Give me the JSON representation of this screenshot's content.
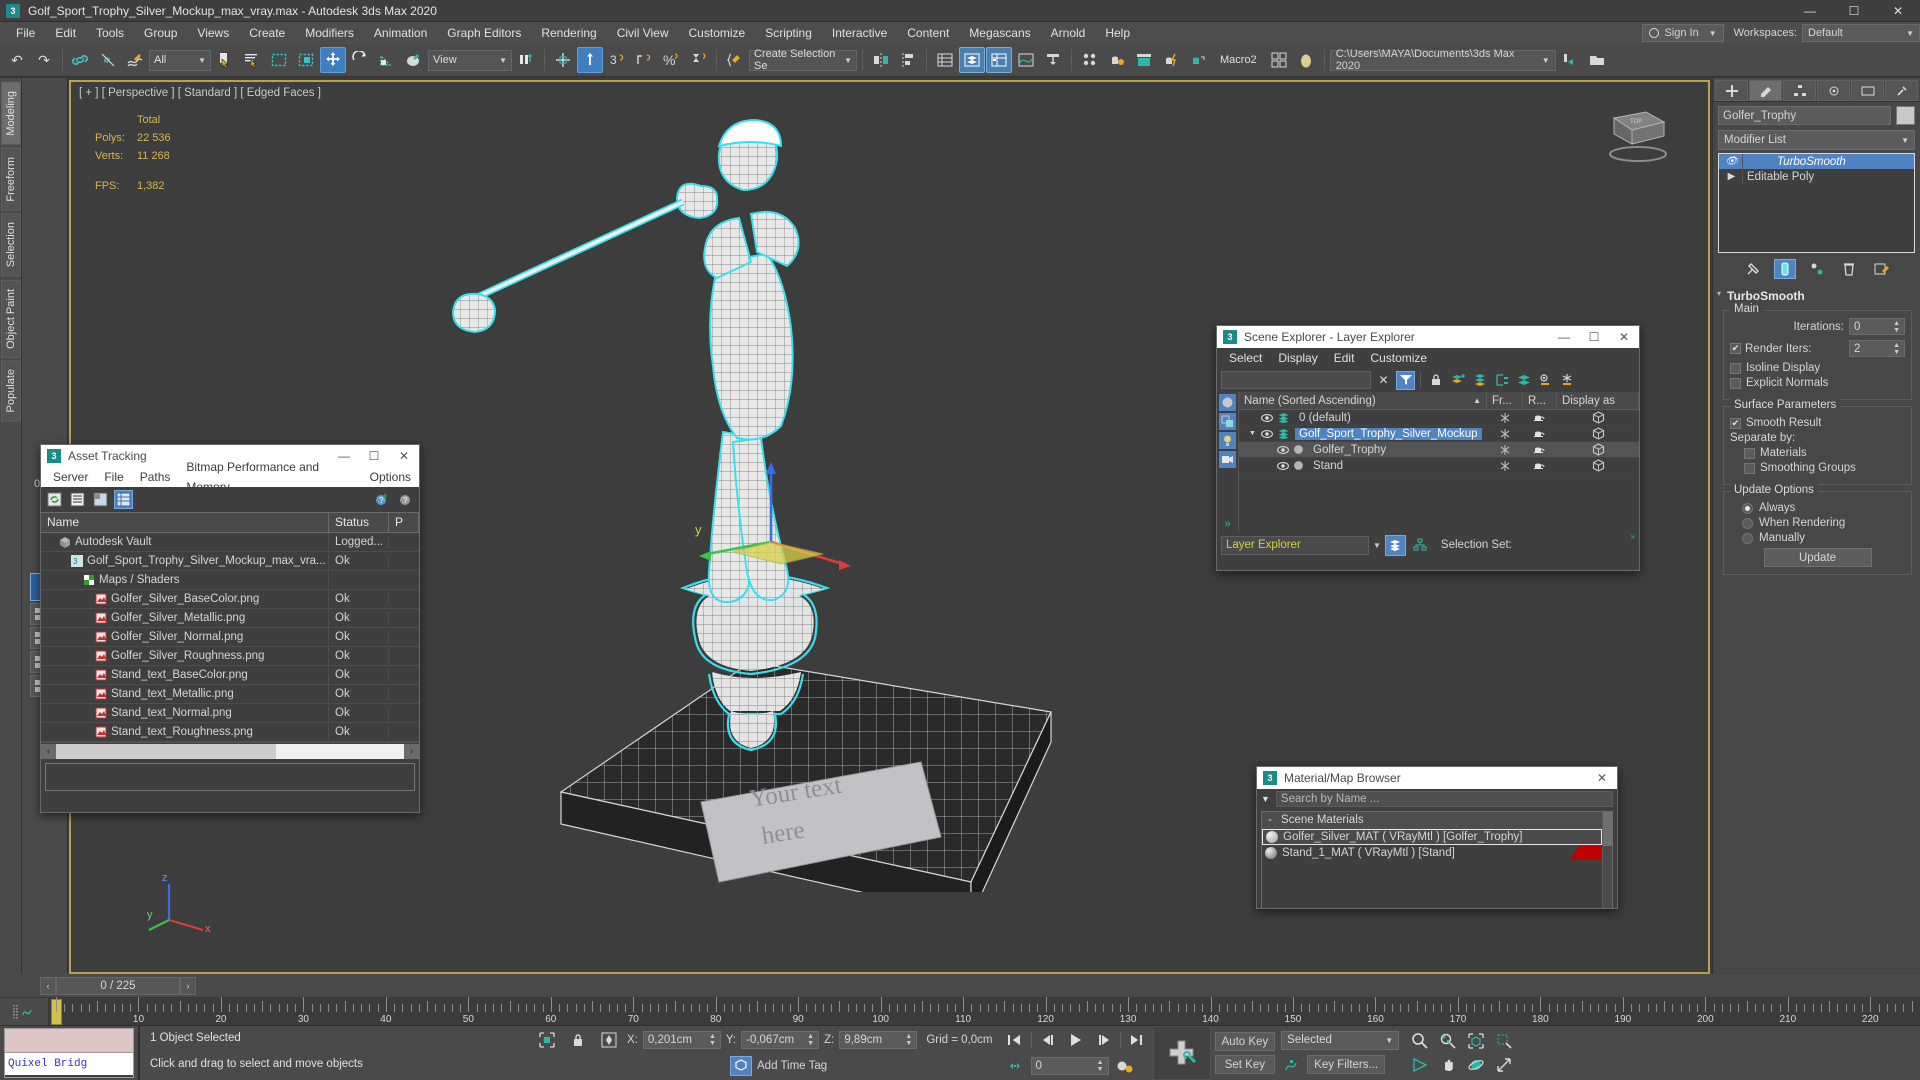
{
  "window": {
    "title": "Golf_Sport_Trophy_Silver_Mockup_max_vray.max - Autodesk 3ds Max 2020",
    "app_icon": "3ds-max-icon",
    "minimize": "—",
    "maximize": "☐",
    "close": "✕"
  },
  "menubar": {
    "items": [
      "File",
      "Edit",
      "Tools",
      "Group",
      "Views",
      "Create",
      "Modifiers",
      "Animation",
      "Graph Editors",
      "Rendering",
      "Civil View",
      "Customize",
      "Scripting",
      "Interactive",
      "Content",
      "Megascans",
      "Arnold",
      "Help"
    ],
    "sign_in": "Sign In",
    "workspaces_label": "Workspaces:",
    "workspace_value": "Default"
  },
  "toolbar": {
    "selection_filter": "All",
    "reference_coord": "View",
    "named_selection_sets": "Create Selection Se",
    "macro_label": "Macro2",
    "project_path": "C:\\Users\\MAYA\\Documents\\3ds Max 2020"
  },
  "left_tabs": [
    "Modeling",
    "Freeform",
    "Selection",
    "Object Paint",
    "Populate"
  ],
  "viewport": {
    "label": "[ + ] [ Perspective ] [ Standard ] [ Edged Faces ]",
    "stats_header": "Total",
    "stats": [
      {
        "label": "Polys:",
        "value": "22 536"
      },
      {
        "label": "Verts:",
        "value": "11 268"
      }
    ],
    "fps_label": "FPS:",
    "fps_value": "1,382",
    "plaque_text_line1": "Your text",
    "plaque_text_line2": "here",
    "axis_x": "x",
    "axis_y": "y",
    "axis_z": "z",
    "viewcube_label": "TOP",
    "selection_highlight_color": "#35e0f0",
    "border_color": "#b8a24a"
  },
  "command_panel": {
    "tabs": [
      "create",
      "modify",
      "hierarchy",
      "motion",
      "display",
      "utilities"
    ],
    "selected_tab": "modify",
    "object_name": "Golfer_Trophy",
    "object_color": "#c9c9c9",
    "modifier_list_label": "Modifier List",
    "modifier_stack": [
      {
        "name": "TurboSmooth",
        "selected": true,
        "eye": true
      },
      {
        "name": "Editable Poly",
        "selected": false,
        "eye": false
      }
    ],
    "stack_buttons": [
      "pin-stack-icon",
      "show-end-result-icon",
      "make-unique-icon",
      "remove-modifier-icon",
      "configure-modifier-sets-icon"
    ],
    "rollout": {
      "title": "TurboSmooth",
      "main_group": "Main",
      "iterations_label": "Iterations:",
      "iterations_value": "0",
      "render_iters_label": "Render Iters:",
      "render_iters_value": "2",
      "render_iters_checked": true,
      "isoline_display": "Isoline Display",
      "isoline_checked": false,
      "explicit_normals": "Explicit Normals",
      "explicit_checked": false,
      "surface_group": "Surface Parameters",
      "smooth_result": "Smooth Result",
      "smooth_checked": true,
      "separate_by": "Separate by:",
      "materials": "Materials",
      "materials_checked": false,
      "smoothing_groups": "Smoothing Groups",
      "smoothing_checked": false,
      "update_group": "Update Options",
      "update_options": [
        {
          "label": "Always",
          "selected": true
        },
        {
          "label": "When Rendering",
          "selected": false
        },
        {
          "label": "Manually",
          "selected": false
        }
      ],
      "update_button": "Update"
    }
  },
  "asset_tracking": {
    "title": "Asset Tracking",
    "menu": [
      "Server",
      "File",
      "Paths",
      "Bitmap Performance and Memory",
      "Options"
    ],
    "columns": [
      "Name",
      "Status",
      "P"
    ],
    "rows": [
      {
        "name": "Autodesk Vault",
        "status": "Logged...",
        "indent": 1,
        "icon": "vault-icon"
      },
      {
        "name": "Golf_Sport_Trophy_Silver_Mockup_max_vra...",
        "status": "Ok",
        "indent": 2,
        "icon": "max-file-icon"
      },
      {
        "name": "Maps / Shaders",
        "status": "",
        "indent": 3,
        "icon": "maps-icon"
      },
      {
        "name": "Golfer_Silver_BaseColor.png",
        "status": "Ok",
        "indent": 4,
        "icon": "png-icon"
      },
      {
        "name": "Golfer_Silver_Metallic.png",
        "status": "Ok",
        "indent": 4,
        "icon": "png-icon"
      },
      {
        "name": "Golfer_Silver_Normal.png",
        "status": "Ok",
        "indent": 4,
        "icon": "png-icon"
      },
      {
        "name": "Golfer_Silver_Roughness.png",
        "status": "Ok",
        "indent": 4,
        "icon": "png-icon"
      },
      {
        "name": "Stand_text_BaseColor.png",
        "status": "Ok",
        "indent": 4,
        "icon": "png-icon"
      },
      {
        "name": "Stand_text_Metallic.png",
        "status": "Ok",
        "indent": 4,
        "icon": "png-icon"
      },
      {
        "name": "Stand_text_Normal.png",
        "status": "Ok",
        "indent": 4,
        "icon": "png-icon"
      },
      {
        "name": "Stand_text_Roughness.png",
        "status": "Ok",
        "indent": 4,
        "icon": "png-icon"
      }
    ]
  },
  "scene_explorer": {
    "title": "Scene Explorer - Layer Explorer",
    "menu": [
      "Select",
      "Display",
      "Edit",
      "Customize"
    ],
    "search_value": "",
    "columns": [
      "Name (Sorted Ascending)",
      "Fr...",
      "R...",
      "Display as Box"
    ],
    "sort_arrow": "▲",
    "rows": [
      {
        "name": "0 (default)",
        "indent": 1,
        "type": "layer",
        "selected": false,
        "expander": ""
      },
      {
        "name": "Golf_Sport_Trophy_Silver_Mockup",
        "indent": 1,
        "type": "layer",
        "selected": true,
        "expander": "▼"
      },
      {
        "name": "Golfer_Trophy",
        "indent": 2,
        "type": "object",
        "selected": false,
        "highlight": true,
        "expander": ""
      },
      {
        "name": "Stand",
        "indent": 2,
        "type": "object",
        "selected": false,
        "expander": ""
      }
    ],
    "footer_dropdown": "Layer Explorer",
    "selection_set_label": "Selection Set:"
  },
  "material_browser": {
    "title": "Material/Map Browser",
    "search_placeholder": "Search by Name ...",
    "group_label": "Scene Materials",
    "group_toggle": "-",
    "items": [
      {
        "name": "Golfer_Silver_MAT  ( VRayMtl )  [Golfer_Trophy]",
        "selected": true,
        "swatch": "#b9b9b9"
      },
      {
        "name": "Stand_1_MAT  ( VRayMtl )  [Stand]",
        "selected": false,
        "swatch": "#8e8e8e"
      }
    ],
    "accent_color": "#c00000"
  },
  "timeline": {
    "frame_current": "0 / 225",
    "prev_arrow": "‹",
    "next_arrow": "›",
    "ticks_labeled": [
      10,
      20,
      30,
      40,
      50,
      60,
      70,
      80,
      90,
      100,
      110,
      120,
      130,
      140,
      150,
      160,
      170,
      180,
      190,
      200,
      210,
      220
    ],
    "range_start": 0,
    "range_end": 225,
    "slider_frame": 0
  },
  "statusbar": {
    "mr_render_label": "Quixel Bridg",
    "selection_status": "1 Object Selected",
    "prompt": "Click and drag to select and move objects",
    "coords": [
      {
        "axis": "X:",
        "value": "0,201cm"
      },
      {
        "axis": "Y:",
        "value": "-0,067cm"
      },
      {
        "axis": "Z:",
        "value": "9,89cm"
      }
    ],
    "grid_text": "Grid = 0,0cm",
    "add_time_tag": "Add Time Tag",
    "key_frame_value": "0",
    "auto_key": "Auto Key",
    "set_key": "Set Key",
    "key_filters": "Key Filters...",
    "key_mode_selected": "Selected"
  }
}
